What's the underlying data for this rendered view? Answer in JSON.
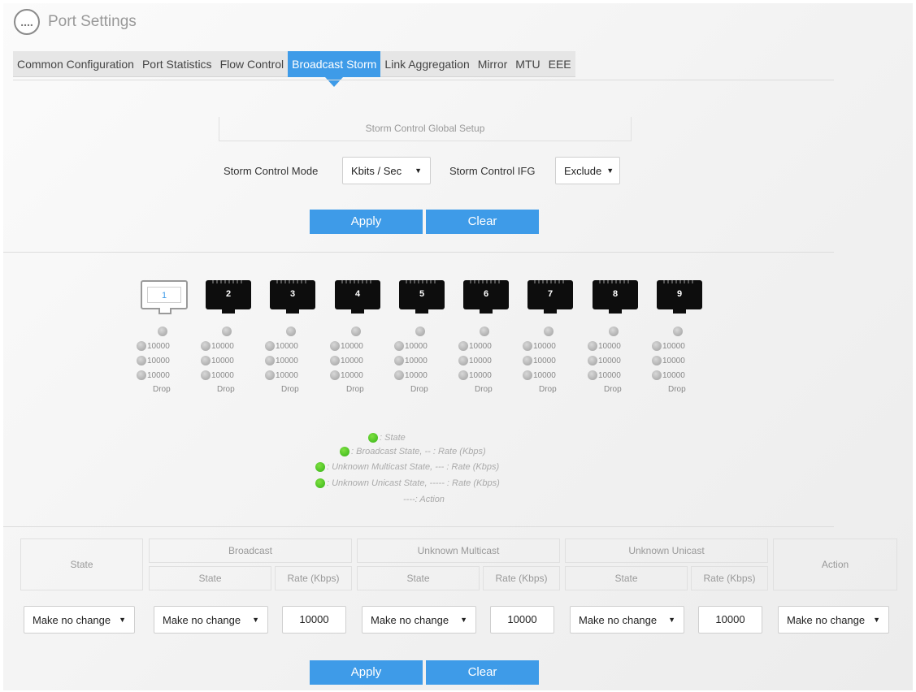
{
  "header": {
    "menu_icon": "....",
    "title": "Port Settings"
  },
  "tabs": [
    {
      "label": "Common Configuration"
    },
    {
      "label": "Port Statistics"
    },
    {
      "label": "Flow Control"
    },
    {
      "label": "Broadcast Storm"
    },
    {
      "label": "Link Aggregation"
    },
    {
      "label": "Mirror"
    },
    {
      "label": "MTU"
    },
    {
      "label": "EEE"
    }
  ],
  "active_tab": "Broadcast Storm",
  "global_setup": {
    "title": "Storm Control Global Setup",
    "mode_label": "Storm Control Mode",
    "mode_value": "Kbits / Sec",
    "ifg_label": "Storm Control IFG",
    "ifg_value": "Exclude",
    "apply": "Apply",
    "clear": "Clear"
  },
  "ports": [
    {
      "num": "1",
      "selected": true,
      "r1": "10000",
      "r2": "10000",
      "r3": "10000",
      "action": "Drop"
    },
    {
      "num": "2",
      "selected": false,
      "r1": "10000",
      "r2": "10000",
      "r3": "10000",
      "action": "Drop"
    },
    {
      "num": "3",
      "selected": false,
      "r1": "10000",
      "r2": "10000",
      "r3": "10000",
      "action": "Drop"
    },
    {
      "num": "4",
      "selected": false,
      "r1": "10000",
      "r2": "10000",
      "r3": "10000",
      "action": "Drop"
    },
    {
      "num": "5",
      "selected": false,
      "r1": "10000",
      "r2": "10000",
      "r3": "10000",
      "action": "Drop"
    },
    {
      "num": "6",
      "selected": false,
      "r1": "10000",
      "r2": "10000",
      "r3": "10000",
      "action": "Drop"
    },
    {
      "num": "7",
      "selected": false,
      "r1": "10000",
      "r2": "10000",
      "r3": "10000",
      "action": "Drop"
    },
    {
      "num": "8",
      "selected": false,
      "r1": "10000",
      "r2": "10000",
      "r3": "10000",
      "action": "Drop"
    },
    {
      "num": "9",
      "selected": false,
      "r1": "10000",
      "r2": "10000",
      "r3": "10000",
      "action": "Drop"
    }
  ],
  "legend": {
    "state": ": State",
    "broadcast": ": Broadcast State, -- : Rate (Kbps)",
    "multicast": ": Unknown Multicast State, --- : Rate (Kbps)",
    "unicast": ": Unknown Unicast State, ----- : Rate (Kbps)",
    "action": "----: Action"
  },
  "table": {
    "state": "State",
    "broadcast": "Broadcast",
    "multicast": "Unknown Multicast",
    "unicast": "Unknown Unicast",
    "action": "Action",
    "sub_state": "State",
    "sub_rate": "Rate (Kbps)"
  },
  "row": {
    "state": "Make no change",
    "bc_state": "Make no change",
    "bc_rate": "10000",
    "mc_state": "Make no change",
    "mc_rate": "10000",
    "uc_state": "Make no change",
    "uc_rate": "10000",
    "action": "Make no change",
    "arrow": "▼"
  },
  "bottom": {
    "apply": "Apply",
    "clear": "Clear"
  },
  "colors": {
    "accent": "#3e9be8",
    "green": "#34b316",
    "grey_dot": "#9e9e9e"
  }
}
